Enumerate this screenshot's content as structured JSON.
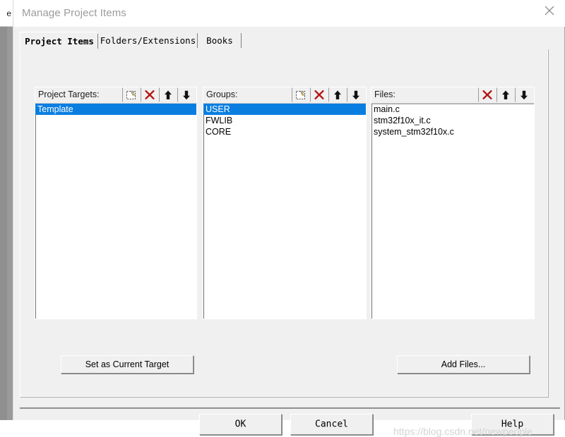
{
  "background_window": {
    "tab_fragment": "e"
  },
  "titlebar": {
    "title": "Manage Project Items",
    "close_icon": "close-icon"
  },
  "tabs": [
    {
      "label": "Project Items",
      "active": true
    },
    {
      "label": "Folders/Extensions",
      "active": false
    },
    {
      "label": "Books",
      "active": false
    }
  ],
  "columns": [
    {
      "id": "project-targets",
      "label": "Project Targets:",
      "buttons": [
        {
          "icon": "new-item-icon",
          "name": "new-target-button"
        },
        {
          "icon": "delete-x-icon",
          "name": "delete-target-button"
        },
        {
          "icon": "arrow-up-icon",
          "name": "move-target-up-button"
        },
        {
          "icon": "arrow-down-icon",
          "name": "move-target-down-button"
        }
      ],
      "items": [
        {
          "text": "Template",
          "selected": true
        }
      ]
    },
    {
      "id": "groups",
      "label": "Groups:",
      "buttons": [
        {
          "icon": "new-item-icon",
          "name": "new-group-button"
        },
        {
          "icon": "delete-x-icon",
          "name": "delete-group-button"
        },
        {
          "icon": "arrow-up-icon",
          "name": "move-group-up-button"
        },
        {
          "icon": "arrow-down-icon",
          "name": "move-group-down-button"
        }
      ],
      "items": [
        {
          "text": "USER",
          "selected": true
        },
        {
          "text": "FWLIB",
          "selected": false
        },
        {
          "text": "CORE",
          "selected": false
        }
      ]
    },
    {
      "id": "files",
      "label": "Files:",
      "buttons": [
        {
          "icon": "delete-x-icon",
          "name": "delete-file-button"
        },
        {
          "icon": "arrow-up-icon",
          "name": "move-file-up-button"
        },
        {
          "icon": "arrow-down-icon",
          "name": "move-file-down-button"
        }
      ],
      "items": [
        {
          "text": "main.c",
          "selected": false
        },
        {
          "text": "stm32f10x_it.c",
          "selected": false
        },
        {
          "text": "system_stm32f10x.c",
          "selected": false
        }
      ]
    }
  ],
  "actions": {
    "set_as_current_target": "Set as Current Target",
    "add_files": "Add Files..."
  },
  "footer": {
    "ok": "OK",
    "cancel": "Cancel",
    "help": "Help"
  },
  "watermark": "https://blog.csdn.net/newpeople",
  "colors": {
    "selection_blue": "#0a7ee0",
    "dialog_face": "#f0f0f0",
    "delete_red": "#b41414",
    "title_gray": "#9b9b9b"
  }
}
